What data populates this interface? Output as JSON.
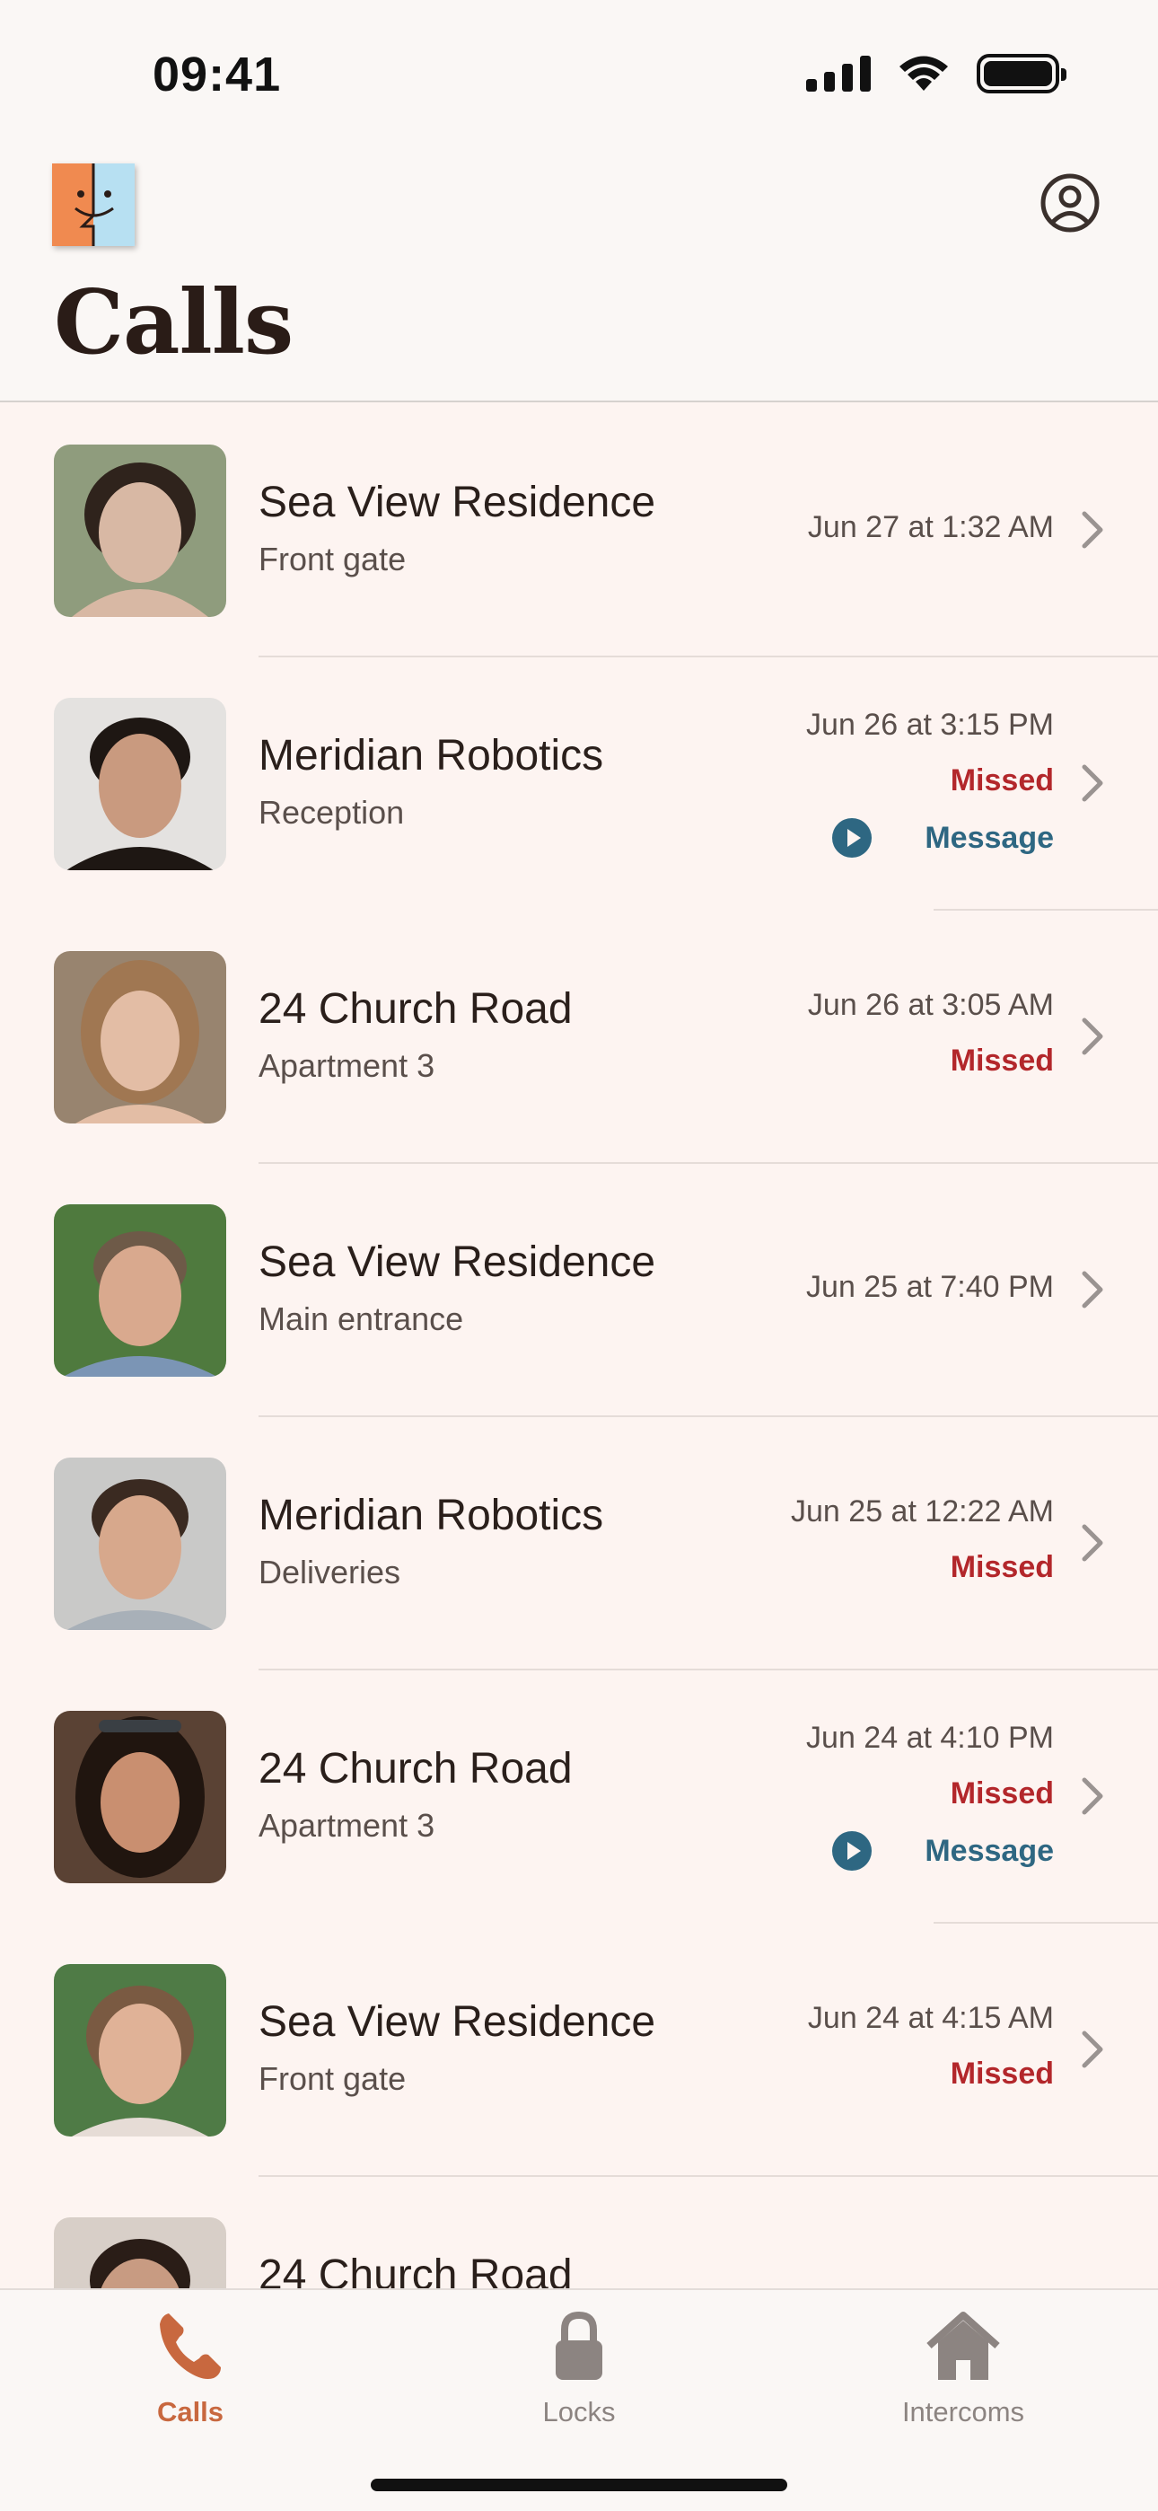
{
  "status_bar": {
    "time": "09:41"
  },
  "header": {
    "title": "Calls"
  },
  "calls": [
    {
      "name": "Sea View Residence",
      "location": "Front gate",
      "date": "Jun 27 at 1:32 AM",
      "missed": "",
      "message": "",
      "avatar_colors": [
        "#8f9c7d",
        "#d8b8a4",
        "#2f231c"
      ]
    },
    {
      "name": "Meridian Robotics",
      "location": "Reception",
      "date": "Jun 26 at 3:15 PM",
      "missed": "Missed",
      "message": "Message",
      "avatar_colors": [
        "#e4e2e0",
        "#c99a7f",
        "#1e1713"
      ]
    },
    {
      "name": "24 Church Road",
      "location": "Apartment 3",
      "date": "Jun 26 at 3:05 AM",
      "missed": "Missed",
      "message": "",
      "avatar_colors": [
        "#98846f",
        "#e3bda5",
        "#a07752"
      ]
    },
    {
      "name": "Sea View Residence",
      "location": "Main entrance",
      "date": "Jun 25 at 7:40 PM",
      "missed": "",
      "message": "",
      "avatar_colors": [
        "#4f7a3e",
        "#d9a98e",
        "#6e5a48"
      ]
    },
    {
      "name": "Meridian Robotics",
      "location": "Deliveries",
      "date": "Jun 25 at 12:22 AM",
      "missed": "Missed",
      "message": "",
      "avatar_colors": [
        "#c9c9c8",
        "#d7a88c",
        "#3a2a21"
      ]
    },
    {
      "name": "24 Church Road",
      "location": "Apartment 3",
      "date": "Jun 24 at 4:10 PM",
      "missed": "Missed",
      "message": "Message",
      "avatar_colors": [
        "#5a4234",
        "#c98f70",
        "#20150f"
      ]
    },
    {
      "name": "Sea View Residence",
      "location": "Front gate",
      "date": "Jun 24 at 4:15 AM",
      "missed": "Missed",
      "message": "",
      "avatar_colors": [
        "#4f7b46",
        "#e0b297",
        "#7a5a42"
      ]
    },
    {
      "name": "24 Church Road",
      "location": "",
      "date": "",
      "missed": "",
      "message": "",
      "avatar_colors": [
        "#d8cfc8",
        "#c89b82",
        "#2a1d17"
      ]
    }
  ],
  "tabs": [
    {
      "label": "Calls",
      "icon": "phone-icon",
      "active": true
    },
    {
      "label": "Locks",
      "icon": "lock-icon",
      "active": false
    },
    {
      "label": "Intercoms",
      "icon": "house-icon",
      "active": false
    }
  ],
  "colors": {
    "accent": "#c8683f",
    "missed": "#b3272b",
    "message": "#2e6782",
    "background": "#fdf4f1"
  }
}
